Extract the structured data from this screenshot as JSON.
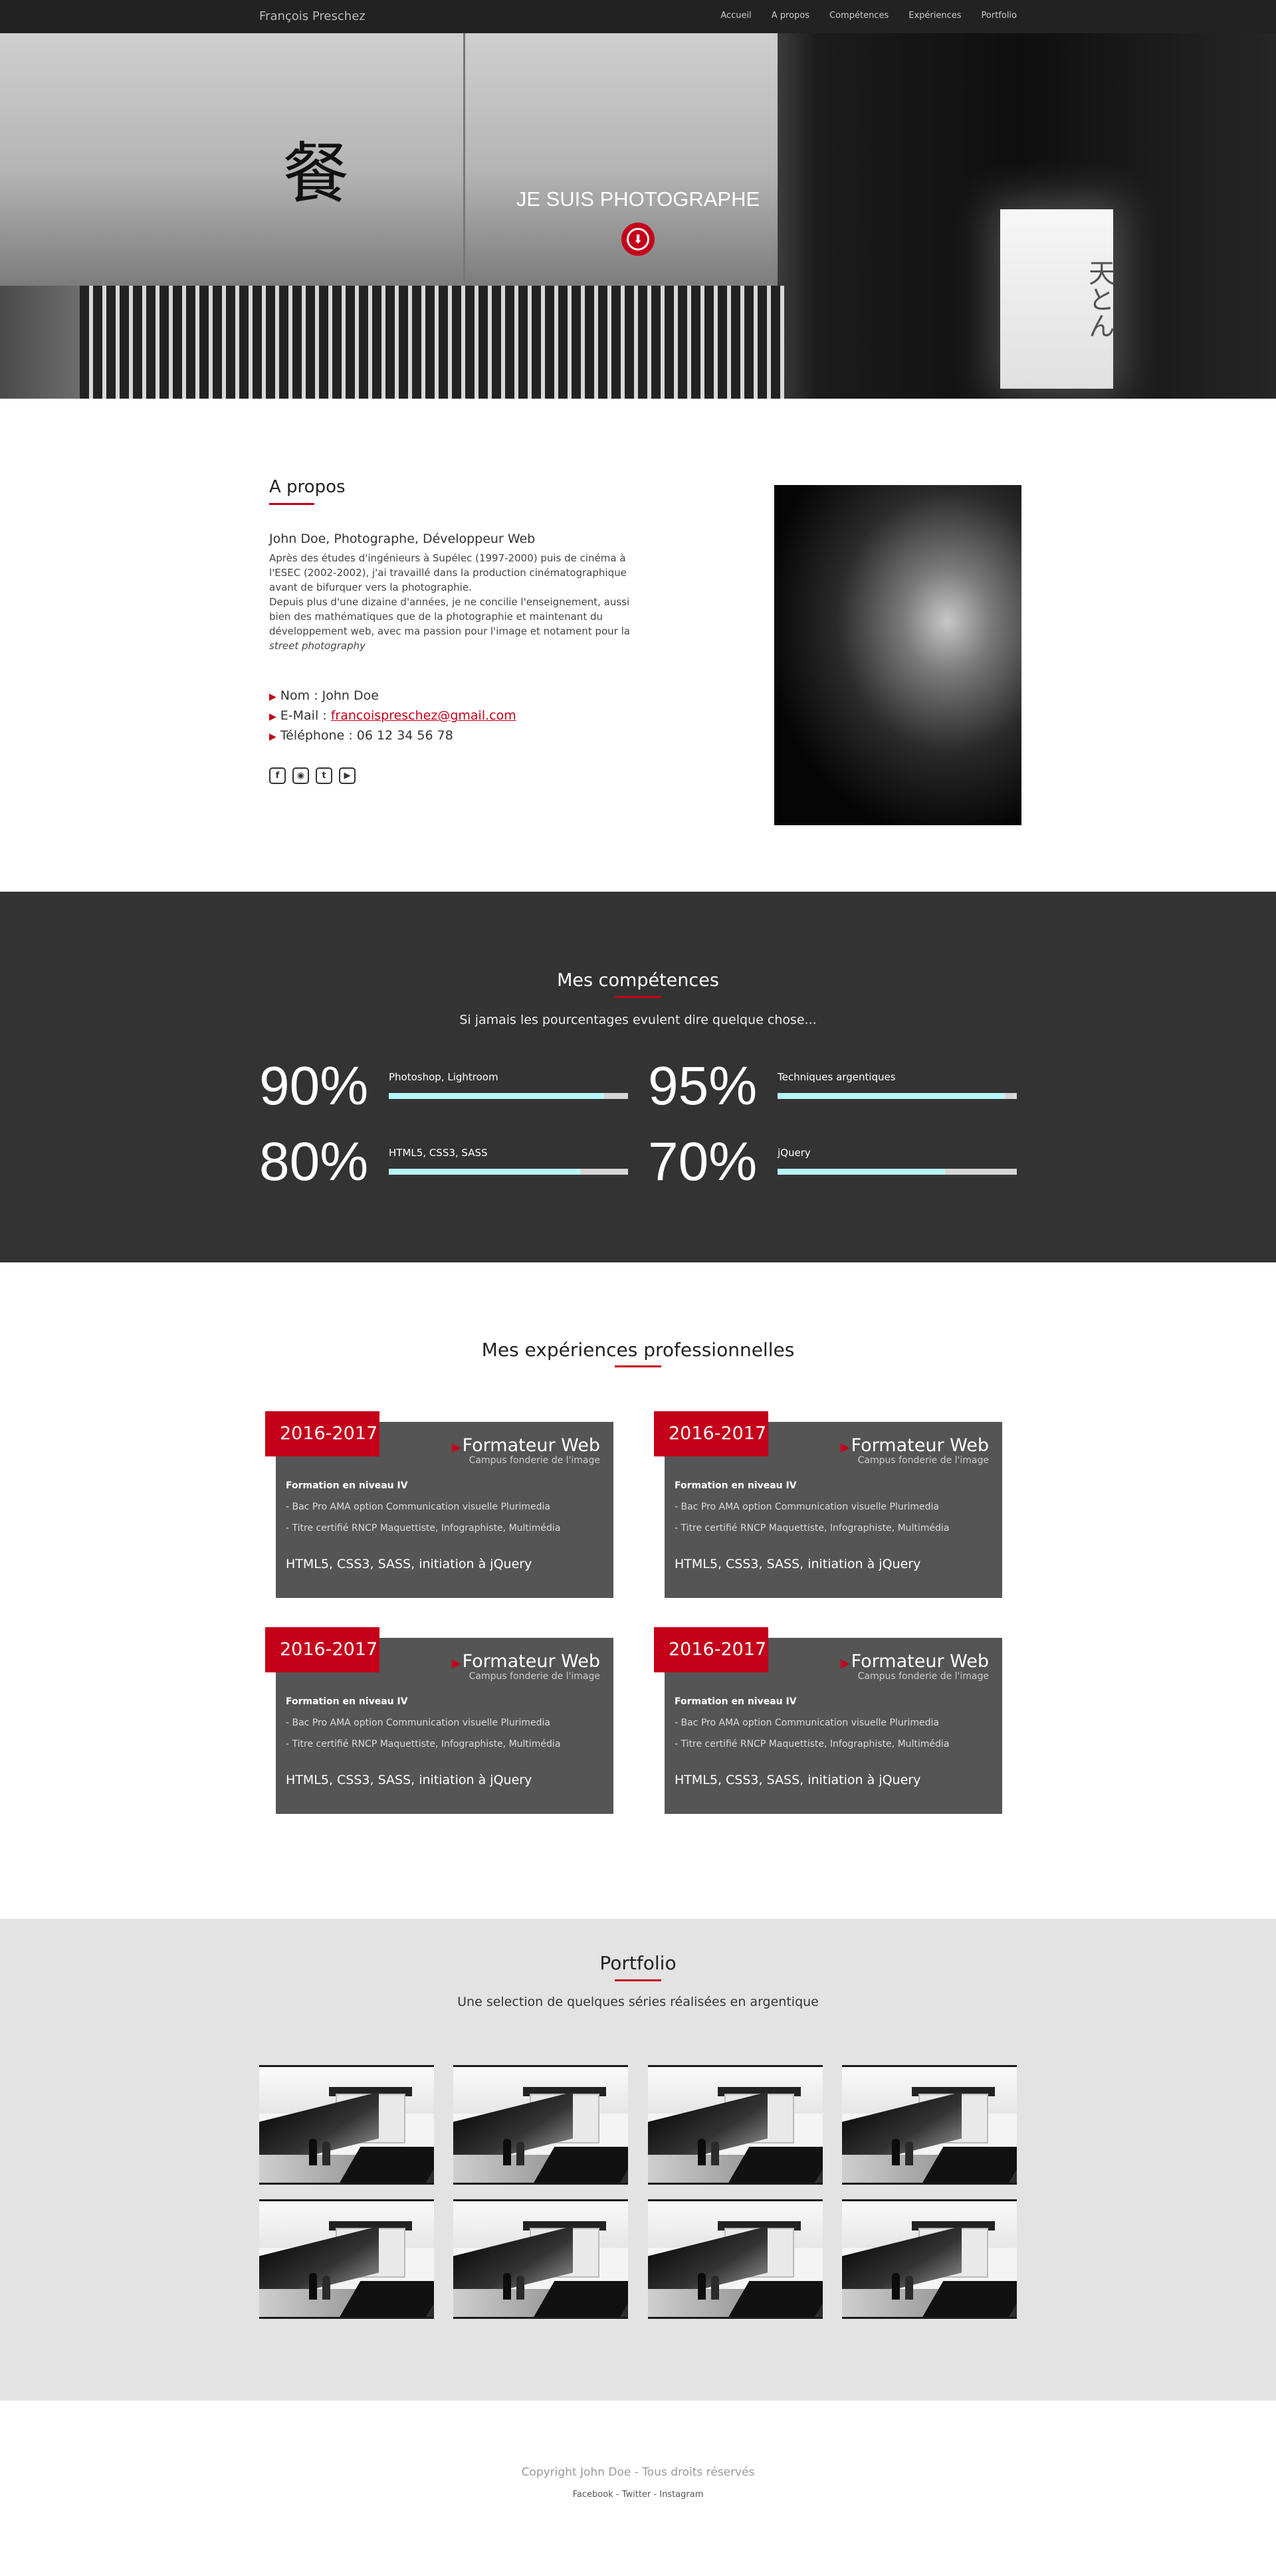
{
  "nav": {
    "brand": "François Preschez",
    "links": [
      "Accueil",
      "A propos",
      "Compétences",
      "Expériences",
      "Portfolio"
    ]
  },
  "hero": {
    "title": "JE SUIS PHOTOGRAPHE",
    "arrow_icon": "arrow-circle-down-icon"
  },
  "about": {
    "title": "A propos",
    "subtitle": "John Doe, Photographe, Développeur Web",
    "bio_p1": "Après des études d'ingénieurs à Supélec (1997-2000) puis de cinéma à l'ESEC (2002-2002), j'ai travaillé dans la production cinématographique avant de bifurquer vers la photographie.",
    "bio_p2": "Depuis plus d'une dizaine d'années, je ne concilie l'enseignement, aussi bien des mathématiques que de la photographie et maintenant du développement web, avec ma passion pour l'image et notament pour la",
    "bio_em": "street photography",
    "name_line": "Nom : John Doe",
    "email_label": "E-Mail : ",
    "email": "francoispreschez@gmail.com",
    "phone_line": "Téléphone : 06 12 34 56 78",
    "social": [
      "facebook-icon",
      "instagram-icon",
      "twitter-icon",
      "youtube-icon"
    ]
  },
  "skills": {
    "title": "Mes compétences",
    "subtitle": "Si jamais les pourcentages evulent dire quelque chose...",
    "items": [
      {
        "pct": "90%",
        "value": 0.9,
        "label": "Photoshop, Lightroom"
      },
      {
        "pct": "95%",
        "value": 0.95,
        "label": "Techniques argentiques"
      },
      {
        "pct": "80%",
        "value": 0.8,
        "label": "HTML5, CSS3, SASS"
      },
      {
        "pct": "70%",
        "value": 0.7,
        "label": "jQuery"
      }
    ],
    "bar_fill_color": "#b8f7f7",
    "bar_track_color": "#d6d6d6"
  },
  "experiences": {
    "title": "Mes expériences professionnelles",
    "cards": [
      {
        "date": "2016-2017",
        "title": "Formateur Web",
        "org": "Campus fonderie de l'image",
        "level": "Formation en niveau IV",
        "item1": "- Bac Pro AMA option Communication visuelle Plurimedia",
        "item2": "- Titre certifié RNCP Maquettiste, Infographiste, Multimédia",
        "tech": "HTML5, CSS3, SASS, initiation à jQuery"
      },
      {
        "date": "2016-2017",
        "title": "Formateur Web",
        "org": "Campus fonderie de l'image",
        "level": "Formation en niveau IV",
        "item1": "- Bac Pro AMA option Communication visuelle Plurimedia",
        "item2": "- Titre certifié RNCP Maquettiste, Infographiste, Multimédia",
        "tech": "HTML5, CSS3, SASS, initiation à jQuery"
      },
      {
        "date": "2016-2017",
        "title": "Formateur Web",
        "org": "Campus fonderie de l'image",
        "level": "Formation en niveau IV",
        "item1": "- Bac Pro AMA option Communication visuelle Plurimedia",
        "item2": "- Titre certifié RNCP Maquettiste, Infographiste, Multimédia",
        "tech": "HTML5, CSS3, SASS, initiation à jQuery"
      },
      {
        "date": "2016-2017",
        "title": "Formateur Web",
        "org": "Campus fonderie de l'image",
        "level": "Formation en niveau IV",
        "item1": "- Bac Pro AMA option Communication visuelle Plurimedia",
        "item2": "- Titre certifié RNCP Maquettiste, Infographiste, Multimédia",
        "tech": "HTML5, CSS3, SASS, initiation à jQuery"
      }
    ]
  },
  "portfolio": {
    "title": "Portfolio",
    "subtitle": "Une selection de quelques séries réalisées en argentique"
  },
  "footer": {
    "copyright": "Copyright John Doe - Tous droits réservés",
    "links": [
      "Facebook",
      "Twitter",
      "Instagram"
    ],
    "separator": " - "
  },
  "colors": {
    "accent": "#c4001a",
    "navbar": "#222222",
    "skills_bg": "#333333",
    "card_bg": "#555555",
    "portfolio_bg": "#e3e3e3"
  }
}
